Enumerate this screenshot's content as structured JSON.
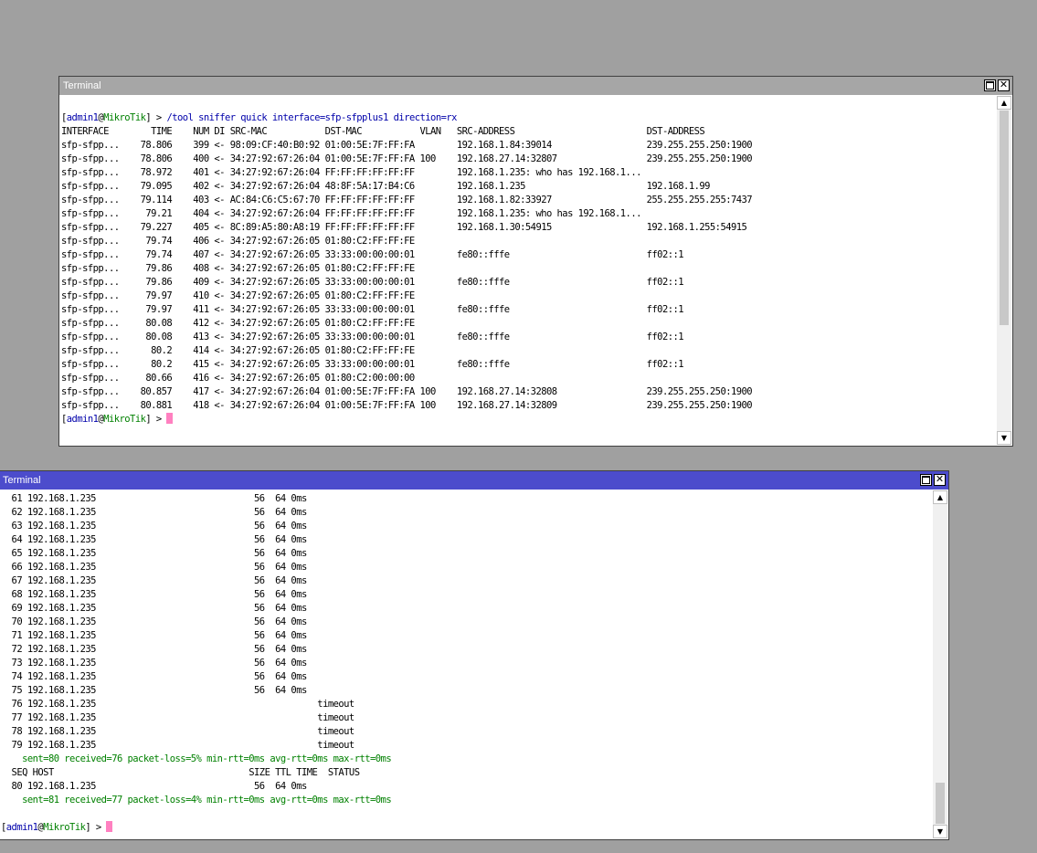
{
  "window1": {
    "title": "Terminal",
    "prompt_user": "admin1",
    "prompt_host": "MikroTik",
    "command": "/tool sniffer quick interface=sfp-sfpplus1 direction=rx",
    "header": "INTERFACE        TIME    NUM DI SRC-MAC           DST-MAC           VLAN   SRC-ADDRESS                         DST-ADDRESS",
    "rows": [
      "sfp-sfpp...    78.806    399 <- 98:09:CF:40:B0:92 01:00:5E:7F:FF:FA        192.168.1.84:39014                  239.255.255.250:1900",
      "sfp-sfpp...    78.806    400 <- 34:27:92:67:26:04 01:00:5E:7F:FF:FA 100    192.168.27.14:32807                 239.255.255.250:1900",
      "sfp-sfpp...    78.972    401 <- 34:27:92:67:26:04 FF:FF:FF:FF:FF:FF        192.168.1.235: who has 192.168.1...",
      "sfp-sfpp...    79.095    402 <- 34:27:92:67:26:04 48:8F:5A:17:B4:C6        192.168.1.235                       192.168.1.99",
      "sfp-sfpp...    79.114    403 <- AC:84:C6:C5:67:70 FF:FF:FF:FF:FF:FF        192.168.1.82:33927                  255.255.255.255:7437",
      "sfp-sfpp...     79.21    404 <- 34:27:92:67:26:04 FF:FF:FF:FF:FF:FF        192.168.1.235: who has 192.168.1...",
      "sfp-sfpp...    79.227    405 <- 8C:89:A5:80:A8:19 FF:FF:FF:FF:FF:FF        192.168.1.30:54915                  192.168.1.255:54915",
      "sfp-sfpp...     79.74    406 <- 34:27:92:67:26:05 01:80:C2:FF:FF:FE",
      "sfp-sfpp...     79.74    407 <- 34:27:92:67:26:05 33:33:00:00:00:01        fe80::fffe                          ff02::1",
      "sfp-sfpp...     79.86    408 <- 34:27:92:67:26:05 01:80:C2:FF:FF:FE",
      "sfp-sfpp...     79.86    409 <- 34:27:92:67:26:05 33:33:00:00:00:01        fe80::fffe                          ff02::1",
      "sfp-sfpp...     79.97    410 <- 34:27:92:67:26:05 01:80:C2:FF:FF:FE",
      "sfp-sfpp...     79.97    411 <- 34:27:92:67:26:05 33:33:00:00:00:01        fe80::fffe                          ff02::1",
      "sfp-sfpp...     80.08    412 <- 34:27:92:67:26:05 01:80:C2:FF:FF:FE",
      "sfp-sfpp...     80.08    413 <- 34:27:92:67:26:05 33:33:00:00:00:01        fe80::fffe                          ff02::1",
      "sfp-sfpp...      80.2    414 <- 34:27:92:67:26:05 01:80:C2:FF:FF:FE",
      "sfp-sfpp...      80.2    415 <- 34:27:92:67:26:05 33:33:00:00:00:01        fe80::fffe                          ff02::1",
      "sfp-sfpp...     80.66    416 <- 34:27:92:67:26:05 01:80:C2:00:00:00",
      "sfp-sfpp...    80.857    417 <- 34:27:92:67:26:04 01:00:5E:7F:FF:FA 100    192.168.27.14:32808                 239.255.255.250:1900",
      "sfp-sfpp...    80.881    418 <- 34:27:92:67:26:04 01:00:5E:7F:FF:FA 100    192.168.27.14:32809                 239.255.255.250:1900"
    ]
  },
  "window2": {
    "title": "Terminal",
    "prompt_user": "admin1",
    "prompt_host": "MikroTik",
    "rows": [
      "  61 192.168.1.235                              56  64 0ms",
      "  62 192.168.1.235                              56  64 0ms",
      "  63 192.168.1.235                              56  64 0ms",
      "  64 192.168.1.235                              56  64 0ms",
      "  65 192.168.1.235                              56  64 0ms",
      "  66 192.168.1.235                              56  64 0ms",
      "  67 192.168.1.235                              56  64 0ms",
      "  68 192.168.1.235                              56  64 0ms",
      "  69 192.168.1.235                              56  64 0ms",
      "  70 192.168.1.235                              56  64 0ms",
      "  71 192.168.1.235                              56  64 0ms",
      "  72 192.168.1.235                              56  64 0ms",
      "  73 192.168.1.235                              56  64 0ms",
      "  74 192.168.1.235                              56  64 0ms",
      "  75 192.168.1.235                              56  64 0ms",
      "  76 192.168.1.235                                          timeout",
      "  77 192.168.1.235                                          timeout",
      "  78 192.168.1.235                                          timeout",
      "  79 192.168.1.235                                          timeout"
    ],
    "stats1": "    sent=80 received=76 packet-loss=5% min-rtt=0ms avg-rtt=0ms max-rtt=0ms",
    "header": "  SEQ HOST                                     SIZE TTL TIME  STATUS",
    "last_row": "  80 192.168.1.235                              56  64 0ms",
    "stats2": "    sent=81 received=77 packet-loss=4% min-rtt=0ms avg-rtt=0ms max-rtt=0ms"
  }
}
